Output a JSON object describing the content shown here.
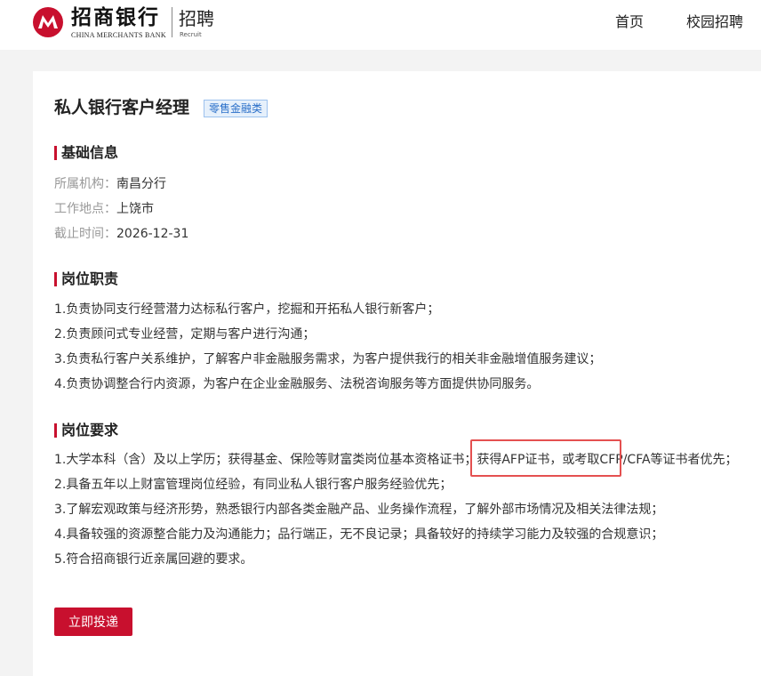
{
  "header": {
    "logo_cn": "招商银行",
    "logo_en": "CHINA MERCHANTS BANK",
    "logo_section": "招聘",
    "logo_section_en": "Recruit",
    "nav": [
      "首页",
      "校园招聘"
    ]
  },
  "job": {
    "title": "私人银行客户经理",
    "tag": "零售金融类"
  },
  "basic": {
    "heading": "基础信息",
    "rows": [
      {
        "label": "所属机构：",
        "value": "南昌分行"
      },
      {
        "label": "工作地点：",
        "value": "上饶市"
      },
      {
        "label": "截止时间：",
        "value": "2026-12-31"
      }
    ]
  },
  "duties": {
    "heading": "岗位职责",
    "items": [
      "1.负责协同支行经营潜力达标私行客户，挖掘和开拓私人银行新客户；",
      "2.负责顾问式专业经营，定期与客户进行沟通；",
      "3.负责私行客户关系维护，了解客户非金融服务需求，为客户提供我行的相关非金融增值服务建议；",
      "4.负责协调整合行内资源，为客户在企业金融服务、法税咨询服务等方面提供协同服务。"
    ]
  },
  "requirements": {
    "heading": "岗位要求",
    "items": [
      "1.大学本科（含）及以上学历；获得基金、保险等财富类岗位基本资格证书；获得AFP证书，或考取CFP/CFA等证书者优先；",
      "2.具备五年以上财富管理岗位经验，有同业私人银行客户服务经验优先；",
      "3.了解宏观政策与经济形势，熟悉银行内部各类金融产品、业务操作流程，了解外部市场情况及相关法律法规；",
      "4.具备较强的资源整合能力及沟通能力；品行端正，无不良记录；具备较好的持续学习能力及较强的合规意识；",
      "5.符合招商银行近亲属回避的要求。"
    ]
  },
  "apply_label": "立即投递",
  "colors": {
    "brand": "#c8102e",
    "highlight": "#e45050",
    "tag": "#2a6fc9"
  },
  "icons": {
    "logo": "cmb-logo-icon"
  }
}
